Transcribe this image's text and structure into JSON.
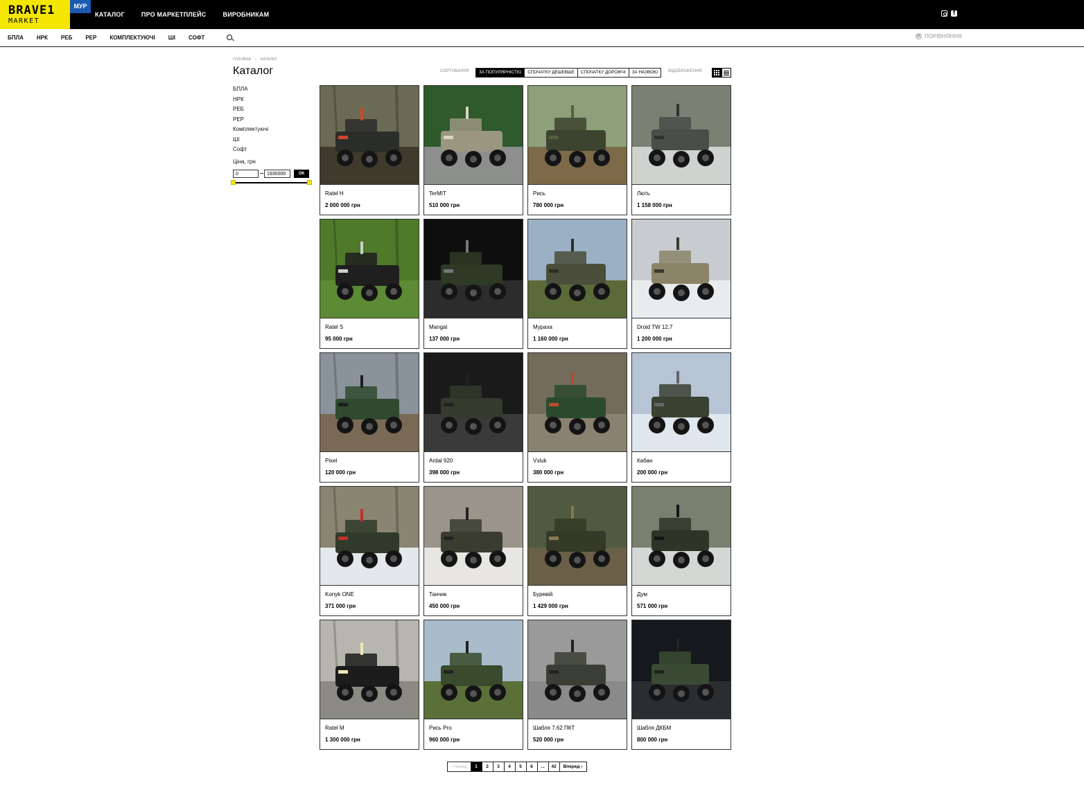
{
  "header": {
    "logo_top": "BRAVE1",
    "logo_bottom": "MARKET",
    "badge": "МУР",
    "nav": [
      "КАТАЛОГ",
      "ПРО МАРКЕТПЛЕЙС",
      "ВИРОБНИКАМ"
    ],
    "social_icons": [
      "instagram-icon",
      "facebook-icon"
    ]
  },
  "categories_bar": {
    "items": [
      "БПЛА",
      "НРК",
      "РЕБ",
      "РЕР",
      "КОМПЛЕКТУЮЧІ",
      "ШІ",
      "СОФТ"
    ],
    "compare_label": "ПОРІВНЯННЯ"
  },
  "breadcrumb": [
    "ГОЛОВНА",
    "КАТАЛОГ"
  ],
  "page_title": "Каталог",
  "sidebar": {
    "categories": [
      "БПЛА",
      "НРК",
      "РЕБ",
      "РЕР",
      "Комплектуючі",
      "ШІ",
      "Софт"
    ],
    "price_label": "Ціна, грн",
    "price_min": "0",
    "price_max": "1930000",
    "ok_label": "ОК"
  },
  "sort": {
    "label": "СОРТУВАННЯ:",
    "options": [
      "ЗА ПОПУЛЯРНІСТЮ",
      "СПОЧАТКУ ДЕШЕВШЕ",
      "СПОЧАТКУ ДОРОЖЧІ",
      "ЗА НАЗВОЮ"
    ],
    "active_index": 0,
    "view_label": "ВІДОБРАЖЕННЯ:"
  },
  "products": [
    {
      "name": "Ratel H",
      "price": "2 000 000 грн",
      "bg": "#6b6a55",
      "ground": "#3f3a2c",
      "body": "#2b2d2a",
      "accent": "#c9462d"
    },
    {
      "name": "TerMIT",
      "price": "510 000 грн",
      "bg": "#2f5a2c",
      "ground": "#8c8f8c",
      "body": "#9a9680",
      "accent": "#d8d4c0"
    },
    {
      "name": "Рись",
      "price": "780 000 грн",
      "bg": "#8ea07a",
      "ground": "#7c6a48",
      "body": "#3c4430",
      "accent": "#555f40"
    },
    {
      "name": "Лють",
      "price": "1 158 000 грн",
      "bg": "#7a8072",
      "ground": "#cfd3cf",
      "body": "#4a4d48",
      "accent": "#303230"
    },
    {
      "name": "Ratel S",
      "price": "95 000 грн",
      "bg": "#4f7a2a",
      "ground": "#5d8a34",
      "body": "#1f1f1f",
      "accent": "#c9d0c8"
    },
    {
      "name": "Mangal",
      "price": "137 000 грн",
      "bg": "#0e0e0e",
      "ground": "#2c2c2c",
      "body": "#2e3a26",
      "accent": "#777"
    },
    {
      "name": "Мураха",
      "price": "1 160 000 грн",
      "bg": "#9bb0c4",
      "ground": "#5a6a38",
      "body": "#4a4e3a",
      "accent": "#2c2d25"
    },
    {
      "name": "Droid TW 12,7",
      "price": "1 200 000 грн",
      "bg": "#c8ccd0",
      "ground": "#e9ecee",
      "body": "#8b8468",
      "accent": "#3a3a32"
    },
    {
      "name": "Pixel",
      "price": "120 000 грн",
      "bg": "#8a939c",
      "ground": "#7a6a55",
      "body": "#2f4a30",
      "accent": "#1e1e1e"
    },
    {
      "name": "Ardal 920",
      "price": "398 000 грн",
      "bg": "#1a1a1a",
      "ground": "#3a3a3a",
      "body": "#343a2c",
      "accent": "#222"
    },
    {
      "name": "Vsluk",
      "price": "380 000 грн",
      "bg": "#746c5a",
      "ground": "#8a8270",
      "body": "#2c4a2e",
      "accent": "#b84a30"
    },
    {
      "name": "Кабан",
      "price": "200 000 грн",
      "bg": "#b6c4d6",
      "ground": "#dfe6ee",
      "body": "#3a4232",
      "accent": "#666"
    },
    {
      "name": "Konyk ONE",
      "price": "371 000 грн",
      "bg": "#8a8472",
      "ground": "#e4e8ec",
      "body": "#2f3a2a",
      "accent": "#c0302a"
    },
    {
      "name": "Танчик",
      "price": "450 000 грн",
      "bg": "#9a948a",
      "ground": "#e8e6e2",
      "body": "#3a3c30",
      "accent": "#222"
    },
    {
      "name": "Буревій",
      "price": "1 429 000 грн",
      "bg": "#4f5a40",
      "ground": "#6a6048",
      "body": "#353a28",
      "accent": "#8a7a50"
    },
    {
      "name": "Дум",
      "price": "571 000 грн",
      "bg": "#7a8070",
      "ground": "#d4d8d4",
      "body": "#2f3428",
      "accent": "#151515"
    },
    {
      "name": "Ratel M",
      "price": "1 300 000 грн",
      "bg": "#b7b6ae",
      "ground": "#8b8a82",
      "body": "#1c1c1c",
      "accent": "#f0e6b0"
    },
    {
      "name": "Рись Pro",
      "price": "960 000 грн",
      "bg": "#a8bccc",
      "ground": "#5a7038",
      "body": "#3a4a2c",
      "accent": "#222"
    },
    {
      "name": "Шабля 7.62 ПКТ",
      "price": "520 000 грн",
      "bg": "#9a9a9a",
      "ground": "#8a8a8a",
      "body": "#3a3e34",
      "accent": "#222"
    },
    {
      "name": "Шабля ДКБМ",
      "price": "800 000 грн",
      "bg": "#15181c",
      "ground": "#2a2e30",
      "body": "#3a4a34",
      "accent": "#222"
    }
  ],
  "pagination": {
    "prev": "Назад",
    "pages": [
      "1",
      "2",
      "3",
      "4",
      "5",
      "6",
      "...",
      "42"
    ],
    "active": "1",
    "next": "Вперед"
  }
}
